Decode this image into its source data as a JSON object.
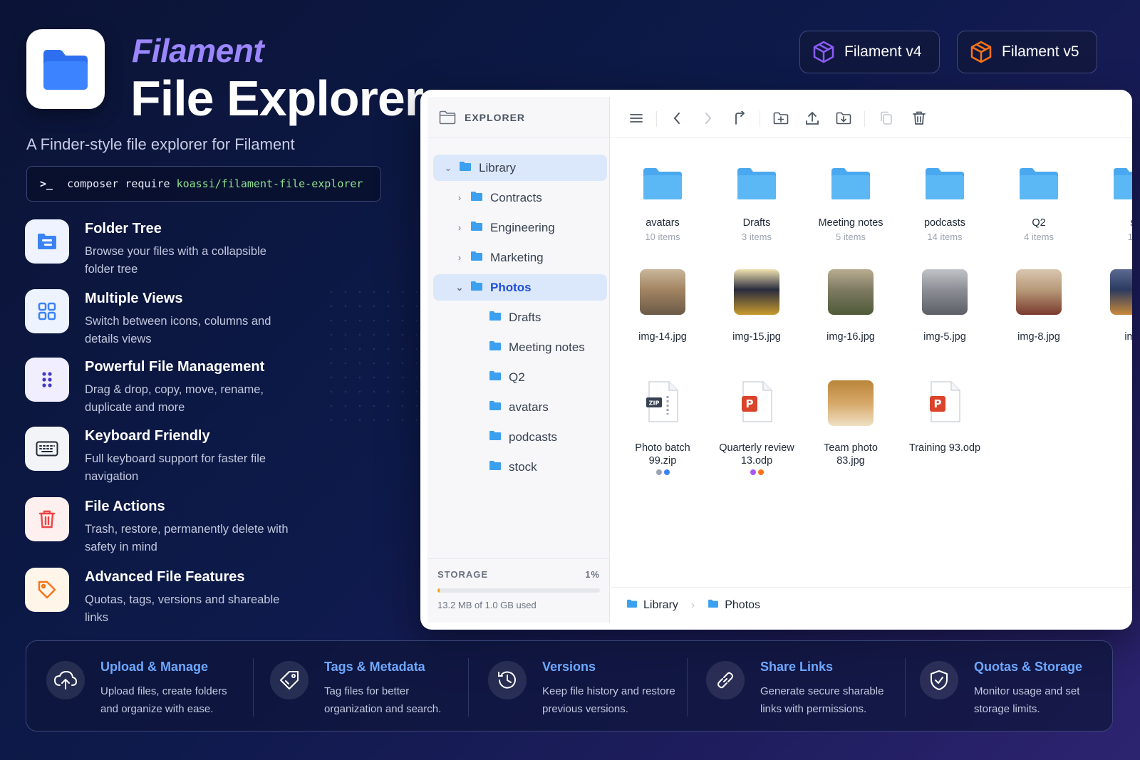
{
  "header": {
    "brand": "Filament",
    "title": "File Explorer",
    "subtitle": "A Finder-style file explorer for Filament",
    "command_prompt": ">_",
    "command": "composer require",
    "package": "koassi/filament-file-explorer"
  },
  "versions": [
    {
      "label": "Filament v4",
      "color": "#8b5cf6"
    },
    {
      "label": "Filament v5",
      "color": "#f97316"
    }
  ],
  "features": [
    {
      "title": "Folder Tree",
      "desc": "Browse your files with a collapsible folder tree",
      "icon": "folder-tree-icon"
    },
    {
      "title": "Multiple Views",
      "desc": "Switch between icons, columns and details views",
      "icon": "grid-icon"
    },
    {
      "title": "Powerful File Management",
      "desc": "Drag & drop, copy, move, rename, duplicate and more",
      "icon": "drag-dots-icon"
    },
    {
      "title": "Keyboard Friendly",
      "desc": "Full keyboard support for faster file navigation",
      "icon": "keyboard-icon"
    },
    {
      "title": "File Actions",
      "desc": "Trash, restore, permanently delete with safety in mind",
      "icon": "trash-icon"
    },
    {
      "title": "Advanced File Features",
      "desc": "Quotas, tags, versions and shareable links",
      "icon": "tag-icon"
    }
  ],
  "explorer": {
    "sidebar_title": "EXPLORER",
    "tree": [
      {
        "label": "Library",
        "level": 0,
        "expanded": true,
        "selected": true
      },
      {
        "label": "Contracts",
        "level": 1,
        "expandable": true
      },
      {
        "label": "Engineering",
        "level": 1,
        "expandable": true
      },
      {
        "label": "Marketing",
        "level": 1,
        "expandable": true
      },
      {
        "label": "Photos",
        "level": 1,
        "expanded": true,
        "active": true
      },
      {
        "label": "Drafts",
        "level": 2
      },
      {
        "label": "Meeting notes",
        "level": 2
      },
      {
        "label": "Q2",
        "level": 2
      },
      {
        "label": "avatars",
        "level": 2
      },
      {
        "label": "podcasts",
        "level": 2
      },
      {
        "label": "stock",
        "level": 2
      }
    ],
    "storage": {
      "label": "STORAGE",
      "percent_label": "1%",
      "fraction": 0.013,
      "used": "13.2 MB of 1.0 GB used"
    },
    "folders": [
      {
        "name": "avatars",
        "meta": "10 items"
      },
      {
        "name": "Drafts",
        "meta": "3 items"
      },
      {
        "name": "Meeting notes",
        "meta": "5 items"
      },
      {
        "name": "podcasts",
        "meta": "14 items"
      },
      {
        "name": "Q2",
        "meta": "4 items"
      },
      {
        "name": "s",
        "meta": "18"
      }
    ],
    "images": [
      {
        "name": "img-14.jpg"
      },
      {
        "name": "img-15.jpg"
      },
      {
        "name": "img-16.jpg"
      },
      {
        "name": "img-5.jpg"
      },
      {
        "name": "img-8.jpg"
      },
      {
        "name": "img"
      }
    ],
    "files": [
      {
        "name": "Photo batch 99.zip",
        "type": "zip",
        "tags": [
          "#9ca3af",
          "#3b82f6"
        ]
      },
      {
        "name": "Quarterly review 13.odp",
        "type": "ppt",
        "tags": [
          "#a855f7",
          "#f97316"
        ]
      },
      {
        "name": "Team photo 83.jpg",
        "type": "photo",
        "tags": []
      },
      {
        "name": "Training 93.odp",
        "type": "ppt",
        "tags": []
      }
    ],
    "breadcrumb": [
      "Library",
      "Photos"
    ]
  },
  "bottom": [
    {
      "title": "Upload & Manage",
      "desc": "Upload files, create folders and organize with ease.",
      "icon": "cloud-upload-icon"
    },
    {
      "title": "Tags & Metadata",
      "desc": "Tag files for better organization and search.",
      "icon": "tag-outline-icon"
    },
    {
      "title": "Versions",
      "desc": "Keep file history and restore previous versions.",
      "icon": "history-icon"
    },
    {
      "title": "Share Links",
      "desc": "Generate secure sharable links with permissions.",
      "icon": "link-icon"
    },
    {
      "title": "Quotas & Storage",
      "desc": "Monitor usage and set storage limits.",
      "icon": "shield-check-icon"
    }
  ]
}
